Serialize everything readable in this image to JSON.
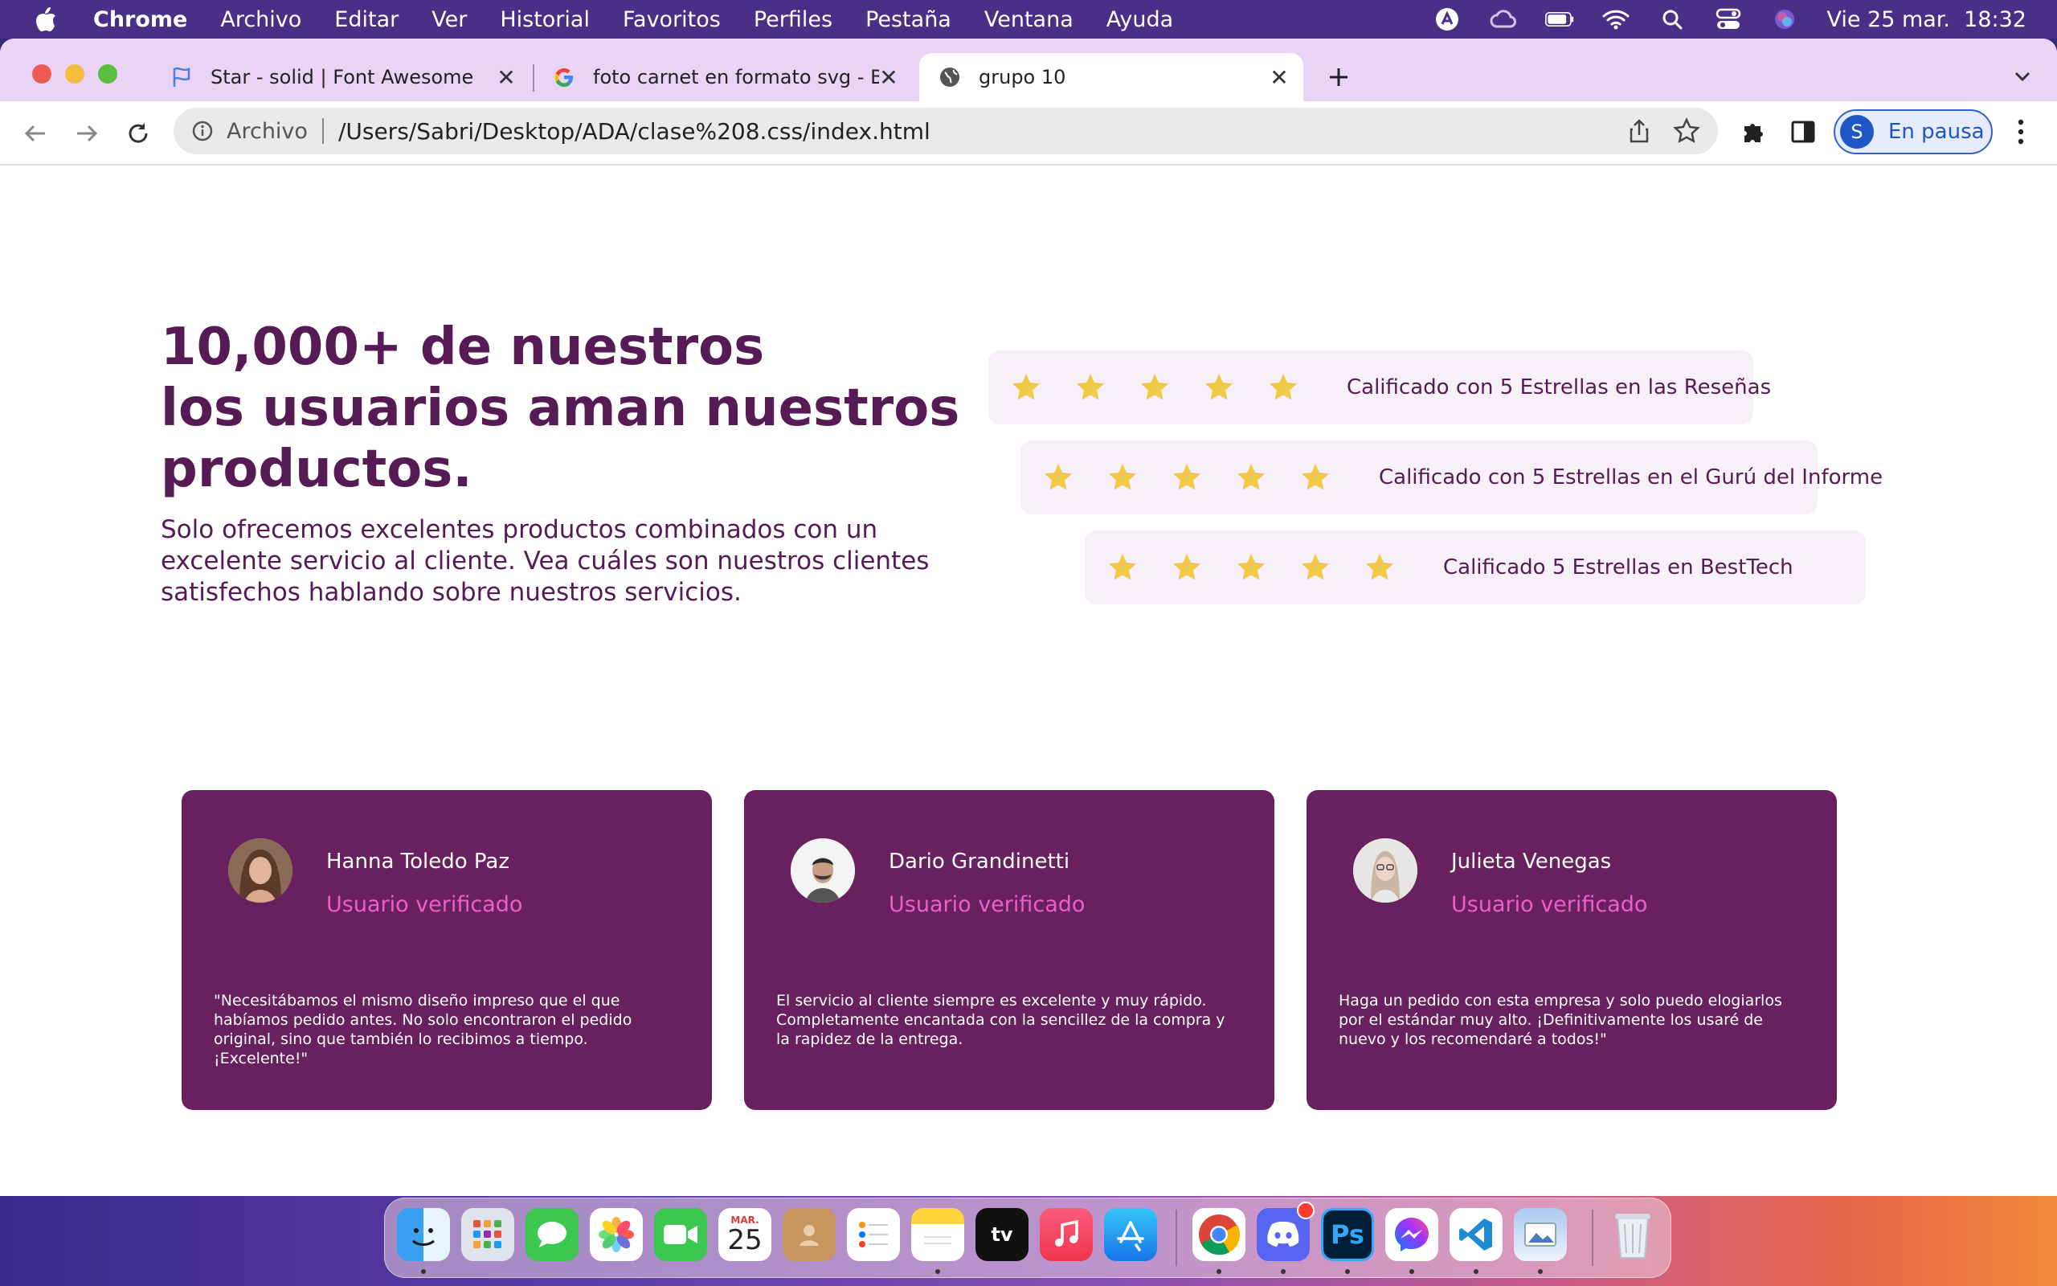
{
  "menubar": {
    "app": "Chrome",
    "menus": [
      "Archivo",
      "Editar",
      "Ver",
      "Historial",
      "Favoritos",
      "Perfiles",
      "Pestaña",
      "Ventana",
      "Ayuda"
    ],
    "clock": "Vie 25 mar.  18:32"
  },
  "browser": {
    "tabs": [
      {
        "title": "Star - solid | Font Awesome"
      },
      {
        "title": "foto carnet en formato svg - Búsqueda"
      },
      {
        "title": "grupo 10"
      }
    ],
    "address": {
      "scheme": "Archivo",
      "url": "/Users/Sabri/Desktop/ADA/clase%208.css/index.html"
    },
    "profile": {
      "initial": "S",
      "label": "En pausa"
    }
  },
  "page": {
    "title_lines": [
      "10,000+ de nuestros",
      "los usuarios aman nuestros",
      "productos."
    ],
    "subtitle": "Solo ofrecemos excelentes productos combinados con un excelente servicio al cliente. Vea cuáles son nuestros clientes satisfechos hablando sobre nuestros servicios.",
    "ratings": [
      {
        "stars": 5,
        "label": "Calificado con 5 Estrellas en las Reseñas"
      },
      {
        "stars": 5,
        "label": "Calificado con 5 Estrellas en el Gurú del Informe"
      },
      {
        "stars": 5,
        "label": "Calificado 5 Estrellas en BestTech"
      }
    ],
    "testimonials": [
      {
        "name": "Hanna Toledo Paz",
        "status": "Usuario verificado",
        "quote": "\"Necesitábamos el mismo diseño impreso que el que habíamos pedido antes. No solo encontraron el pedido original, sino que también lo recibimos a tiempo. ¡Excelente!\""
      },
      {
        "name": "Dario Grandinetti",
        "status": "Usuario verificado",
        "quote": "El servicio al cliente siempre es excelente y muy rápido. Completamente encantada con la sencillez de la compra y la rapidez de la entrega."
      },
      {
        "name": "Julieta Venegas",
        "status": "Usuario verificado",
        "quote": "Haga un pedido con esta empresa y solo puedo elogiarlos por el estándar muy alto. ¡Definitivamente los usaré de nuevo y los recomendaré a todos!\""
      }
    ]
  },
  "dock": {
    "calendar_month": "MAR.",
    "calendar_day": "25",
    "photoshop": "Ps",
    "tv": "tv"
  },
  "colors": {
    "brand_purple": "#561a55",
    "card_bg": "#68205f",
    "verified_pink": "#ec5fc6",
    "star_gold": "#f2c84b",
    "rating_bg": "#f7f0f8"
  }
}
